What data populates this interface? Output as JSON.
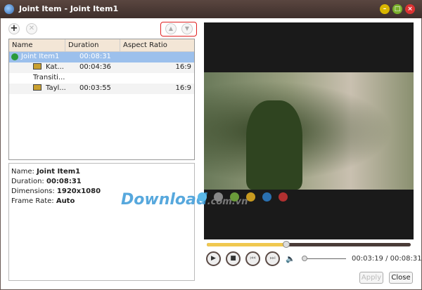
{
  "window": {
    "title": "Joint Item - Joint Item1"
  },
  "toolbar": {
    "add": "+",
    "remove": "✕",
    "up": "▲",
    "down": "▼"
  },
  "tree": {
    "columns": [
      "Name",
      "Duration",
      "Aspect Ratio"
    ],
    "rows": [
      {
        "name": "Joint Item1",
        "duration": "00:08:31",
        "aspect": ""
      },
      {
        "name": "Kat...",
        "duration": "00:04:36",
        "aspect": "16:9"
      },
      {
        "name": "Transiti...",
        "duration": "",
        "aspect": ""
      },
      {
        "name": "Tayl...",
        "duration": "00:03:55",
        "aspect": "16:9"
      }
    ]
  },
  "info": {
    "name_label": "Name:",
    "name": "Joint Item1",
    "duration_label": "Duration:",
    "duration": "00:08:31",
    "dimensions_label": "Dimensions:",
    "dimensions": "1920x1080",
    "frame_rate_label": "Frame Rate:",
    "frame_rate": "Auto"
  },
  "player": {
    "current_time": "00:03:19",
    "separator": "/",
    "total_time": "00:08:31",
    "progress": 0.39,
    "volume": 0.0
  },
  "watermark": {
    "text": "Download",
    "suffix": ".com.vn"
  },
  "dots": [
    "#5bb8e8",
    "#888888",
    "#6a9a3a",
    "#c89a20",
    "#2a70b0",
    "#b03030"
  ],
  "buttons": {
    "apply": "Apply",
    "close": "Close"
  }
}
